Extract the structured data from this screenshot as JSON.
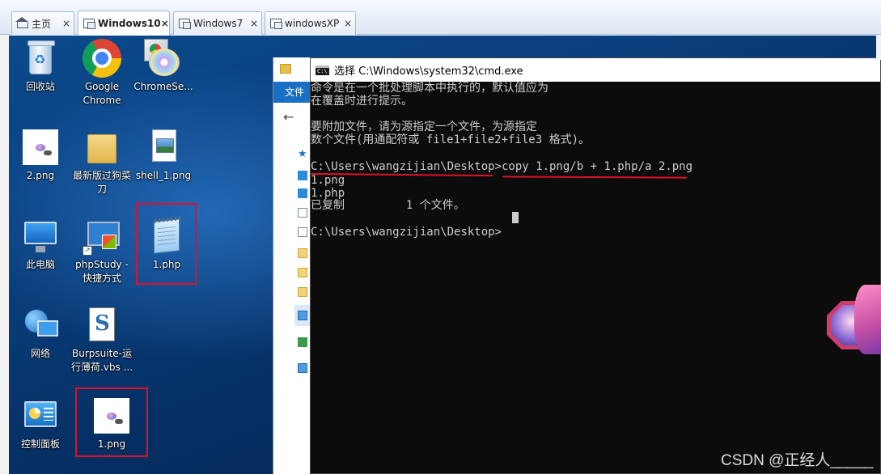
{
  "vm_tabs": [
    {
      "label": "主页",
      "icon": "home-icon",
      "active": false
    },
    {
      "label": "Windows10",
      "icon": "vm-icon",
      "active": true
    },
    {
      "label": "Windows7",
      "icon": "vm-icon",
      "active": false
    },
    {
      "label": "windowsXP",
      "icon": "vm-icon",
      "active": false
    }
  ],
  "desktop": {
    "icons": {
      "recycle_bin": "回收站",
      "chrome": "Google Chrome",
      "chrome_setup": "ChromeSe...",
      "png2": "2.png",
      "folder": "最新版过狗菜刀",
      "shell": "shell_1.png",
      "this_pc": "此电脑",
      "phpstudy": "phpStudy - 快捷方式",
      "php1": "1.php",
      "network": "网络",
      "burpsuite": "Burpsuite-运行薄荷.vbs ...",
      "control_panel": "控制面板",
      "png1": "1.png"
    },
    "highlight_color": "#e0102a"
  },
  "explorer": {
    "ribbon_tab": "文件"
  },
  "cmd": {
    "title": "选择 C:\\Windows\\system32\\cmd.exe",
    "lines": [
      "命令是在一个批处理脚本中执行的，默认值应为",
      "在覆盖时进行提示。",
      "",
      "要附加文件，请为源指定一个文件，为源指定",
      "数个文件(用通配符或 file1+file2+file3 格式)。",
      "",
      "C:\\Users\\wangzijian\\Desktop>copy 1.png/b + 1.php/a 2.png",
      "1.png",
      "1.php",
      "已复制         1 个文件。",
      "",
      "C:\\Users\\wangzijian\\Desktop>"
    ],
    "text_color": "#cccccc",
    "background": "#0c0c0c"
  },
  "watermark": "CSDN @正经人_____"
}
